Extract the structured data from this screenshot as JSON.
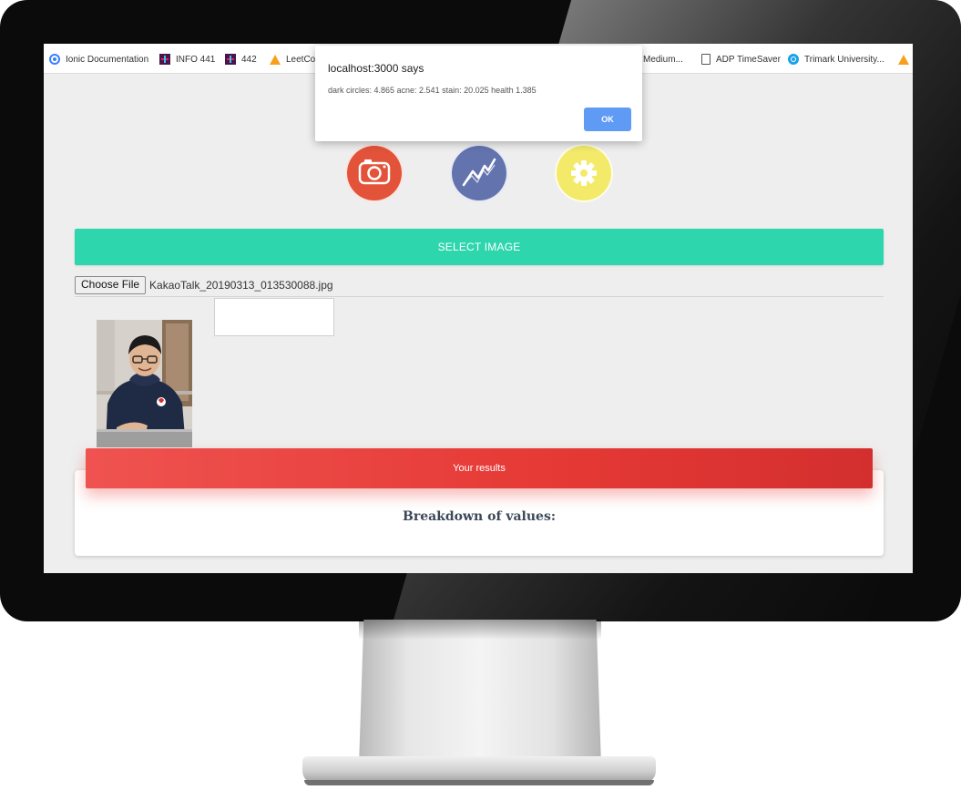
{
  "bookmarks": [
    {
      "label": "Ionic Documentation",
      "icon": "ionic-icon"
    },
    {
      "label": "INFO 441",
      "icon": "slack-icon"
    },
    {
      "label": "442",
      "icon": "slack-icon"
    },
    {
      "label": "LeetCoc",
      "icon": "leetcode-icon"
    },
    {
      "label": "Medium...",
      "icon": "none"
    },
    {
      "label": "ADP TimeSaver",
      "icon": "document-icon"
    },
    {
      "label": "Trimark University...",
      "icon": "trimark-icon"
    }
  ],
  "dialog": {
    "title": "localhost:3000 says",
    "message": "dark circles: 4.865 acne: 2.541 stain: 20.025 health 1.385",
    "ok_label": "OK"
  },
  "nav_icons": [
    {
      "name": "camera-icon",
      "color": "#e2533a"
    },
    {
      "name": "trend-chart-icon",
      "color": "#6373ae"
    },
    {
      "name": "gear-icon",
      "color": "#f3ea6a"
    }
  ],
  "upload": {
    "select_label": "SELECT IMAGE",
    "choose_label": "Choose File",
    "file_name": "KakaoTalk_20190313_013530088.jpg"
  },
  "results": {
    "header": "Your results",
    "heading": "Breakdown of values:"
  },
  "colors": {
    "select_bar": "#2ed6ae",
    "results_header": "#e53935",
    "dialog_button": "#5f9bf5"
  }
}
